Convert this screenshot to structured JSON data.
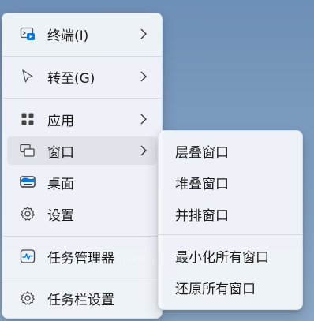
{
  "main_menu": {
    "items": [
      {
        "label": "终端(I)",
        "icon": "terminal-icon"
      },
      {
        "label": "转至(G)",
        "icon": "pointer-icon"
      },
      {
        "label": "应用",
        "icon": "apps-icon"
      },
      {
        "label": "窗口",
        "icon": "windows-icon"
      },
      {
        "label": "桌面",
        "icon": "desktop-icon"
      },
      {
        "label": "设置",
        "icon": "gear-icon"
      },
      {
        "label": "任务管理器",
        "icon": "task-manager-icon"
      },
      {
        "label": "任务栏设置",
        "icon": "gear-icon"
      }
    ]
  },
  "sub_menu": {
    "items": [
      {
        "label": "层叠窗口"
      },
      {
        "label": "堆叠窗口"
      },
      {
        "label": "并排窗口"
      },
      {
        "label": "最小化所有窗口"
      },
      {
        "label": "还原所有窗口"
      }
    ]
  },
  "colors": {
    "accent": "#0067c0",
    "text": "#1a1a1a",
    "background_gradient_top": "#6e8fb7"
  },
  "watermark": "IPCMDI.NET"
}
